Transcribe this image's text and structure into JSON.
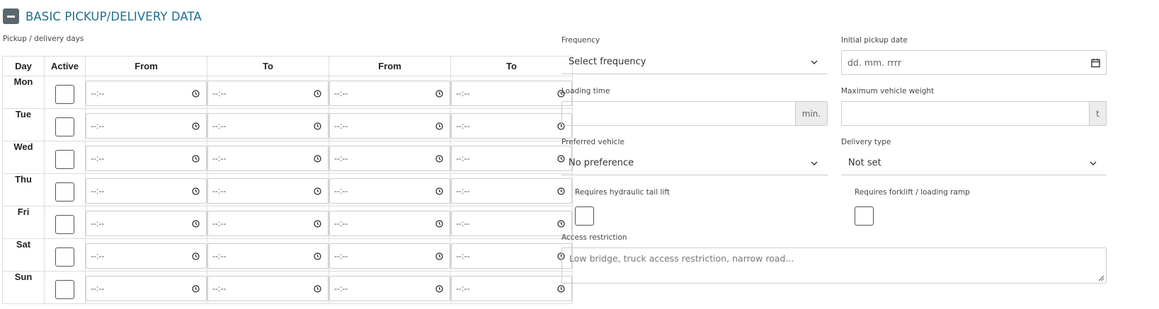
{
  "section": {
    "title": "BASIC PICKUP/DELIVERY DATA",
    "toggle_icon": "minus-icon"
  },
  "schedule": {
    "label": "Pickup / delivery days",
    "headers": [
      "Day",
      "Active",
      "From",
      "To",
      "From",
      "To"
    ],
    "time_placeholder": "--:--",
    "days": [
      {
        "name": "Mon",
        "active": false
      },
      {
        "name": "Tue",
        "active": false
      },
      {
        "name": "Wed",
        "active": false
      },
      {
        "name": "Thu",
        "active": false
      },
      {
        "name": "Fri",
        "active": false
      },
      {
        "name": "Sat",
        "active": false
      },
      {
        "name": "Sun",
        "active": false
      }
    ]
  },
  "form": {
    "frequency": {
      "label": "Frequency",
      "value": "Select frequency"
    },
    "initial_pickup_date": {
      "label": "Initial pickup date",
      "placeholder": "dd. mm. rrrr"
    },
    "loading_time": {
      "label": "Loading time",
      "value": "",
      "unit": "min."
    },
    "max_vehicle_weight": {
      "label": "Maximum vehicle weight",
      "value": "",
      "unit": "t"
    },
    "preferred_vehicle": {
      "label": "Preferred vehicle",
      "value": "No preference"
    },
    "delivery_type": {
      "label": "Delivery type",
      "value": "Not set"
    },
    "hydraulic_tail_lift": {
      "label": "Requires hydraulic tail lift",
      "checked": false
    },
    "forklift_ramp": {
      "label": "Requires forklift / loading ramp",
      "checked": false
    },
    "access_restriction": {
      "label": "Access restriction",
      "placeholder": "Low bridge, truck access restriction, narrow road..."
    }
  }
}
